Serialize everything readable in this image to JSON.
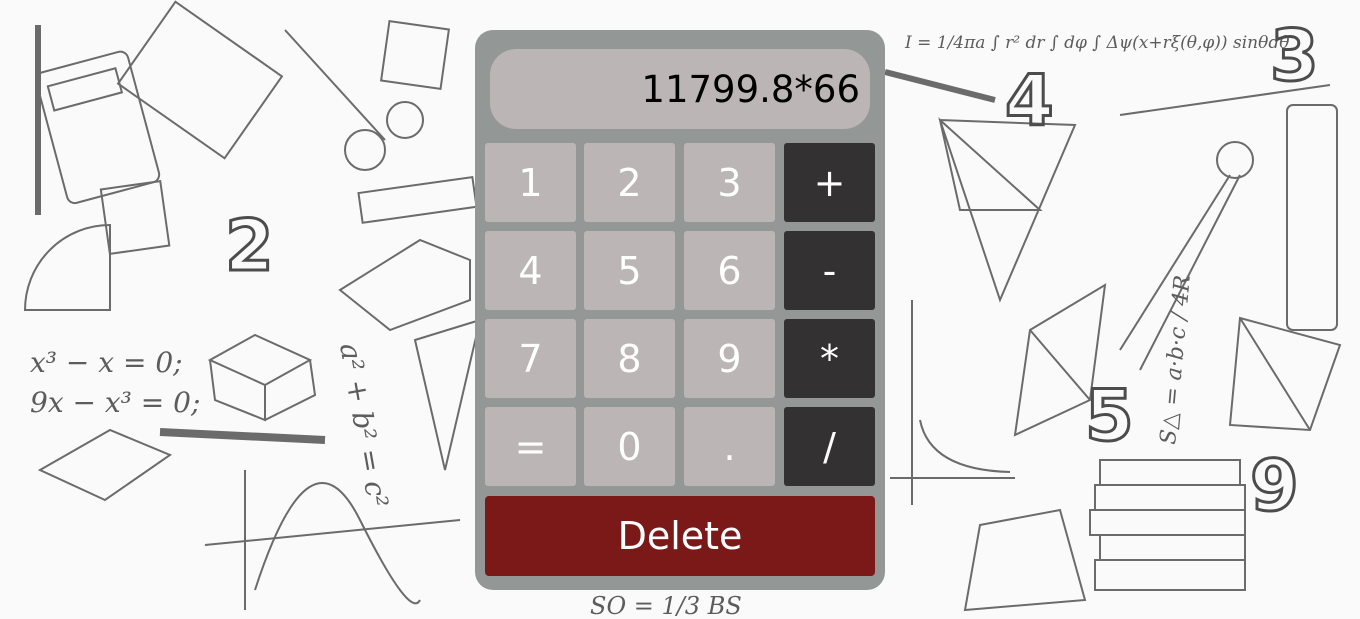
{
  "display": {
    "value": "11799.8*66"
  },
  "keys": {
    "k1": "1",
    "k2": "2",
    "k3": "3",
    "plus": "+",
    "k4": "4",
    "k5": "5",
    "k6": "6",
    "minus": "-",
    "k7": "7",
    "k8": "8",
    "k9": "9",
    "times": "*",
    "equals": "=",
    "k0": "0",
    "dot": ".",
    "divide": "/"
  },
  "delete_label": "Delete",
  "background": {
    "formula_top": "I = 1/4πa ∫ r² dr ∫ dφ ∫ Δψ(x+rξ(θ,φ)) sinθdθ",
    "eq1": "x³ − x = 0;",
    "eq2": "9x − x³ = 0;",
    "vertical_formula": "a² + b² = c²",
    "right_formula": "S△ = a·b·c / 4R",
    "bottom_formula": "SO = 1/3 BS",
    "digits": [
      "3",
      "4",
      "5",
      "9",
      "2"
    ]
  },
  "colors": {
    "panel": "#939896",
    "key": "#bbb5b5",
    "operator": "#333131",
    "delete": "#7b1919"
  }
}
